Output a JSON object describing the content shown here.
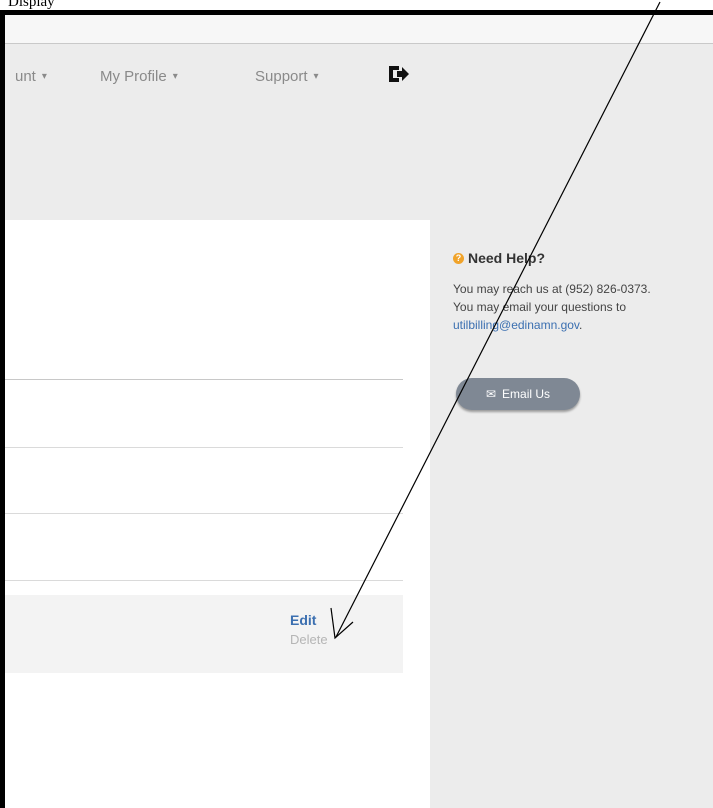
{
  "caption": "Display",
  "nav": {
    "items": [
      {
        "label": "unt",
        "left": 0
      },
      {
        "label": "My Profile"
      },
      {
        "label": "Support"
      }
    ],
    "caret": "▾"
  },
  "help": {
    "title": "Need Help?",
    "line1": "You may reach us at (952) 826-0373.",
    "line2": "You may email your questions to",
    "email": "utilbilling@edinamn.gov",
    "email_suffix": ".",
    "button_label": "Email Us"
  },
  "row_actions": {
    "edit": "Edit",
    "delete": "Delete"
  },
  "colors": {
    "link": "#3b6fb0",
    "muted": "#b5b5b5",
    "sidebar_bg": "#ececec"
  },
  "icons": {
    "logout": "logout-icon",
    "help": "question-circle-icon",
    "email": "envelope-icon"
  }
}
